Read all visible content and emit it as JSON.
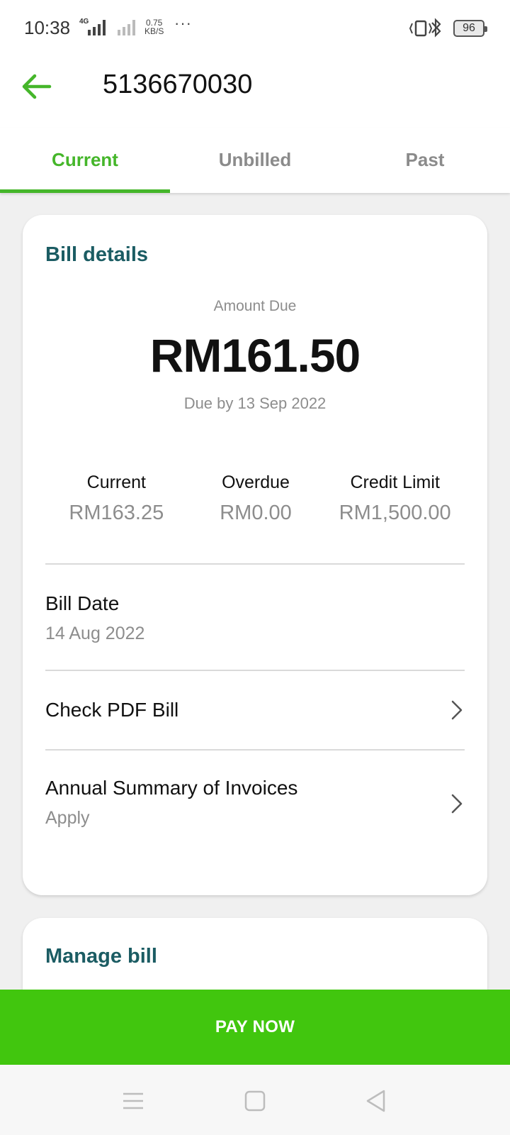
{
  "status_bar": {
    "time": "10:38",
    "network_type": "4G",
    "speed_value": "0.75",
    "speed_unit": "KB/S",
    "overflow": "···",
    "battery": "96"
  },
  "app_bar": {
    "title": "5136670030"
  },
  "tabs": [
    {
      "label": "Current",
      "active": true
    },
    {
      "label": "Unbilled",
      "active": false
    },
    {
      "label": "Past",
      "active": false
    }
  ],
  "bill_details": {
    "heading": "Bill details",
    "amount_label": "Amount Due",
    "amount_value": "RM161.50",
    "due_text": "Due by 13 Sep 2022",
    "stats": [
      {
        "label": "Current",
        "value": "RM163.25"
      },
      {
        "label": "Overdue",
        "value": "RM0.00"
      },
      {
        "label": "Credit Limit",
        "value": "RM1,500.00"
      }
    ],
    "bill_date_label": "Bill Date",
    "bill_date_value": "14 Aug 2022",
    "pdf_bill_label": "Check PDF Bill",
    "annual_summary_label": "Annual Summary of Invoices",
    "annual_summary_sub": "Apply"
  },
  "manage_bill": {
    "heading": "Manage bill"
  },
  "pay_button": {
    "label": "PAY NOW"
  },
  "colors": {
    "accent_green": "#45b62a",
    "pay_green": "#41c60e",
    "heading_teal": "#1b5c63"
  },
  "nav_icons": [
    "menu-icon",
    "home-square-icon",
    "back-triangle-icon"
  ]
}
